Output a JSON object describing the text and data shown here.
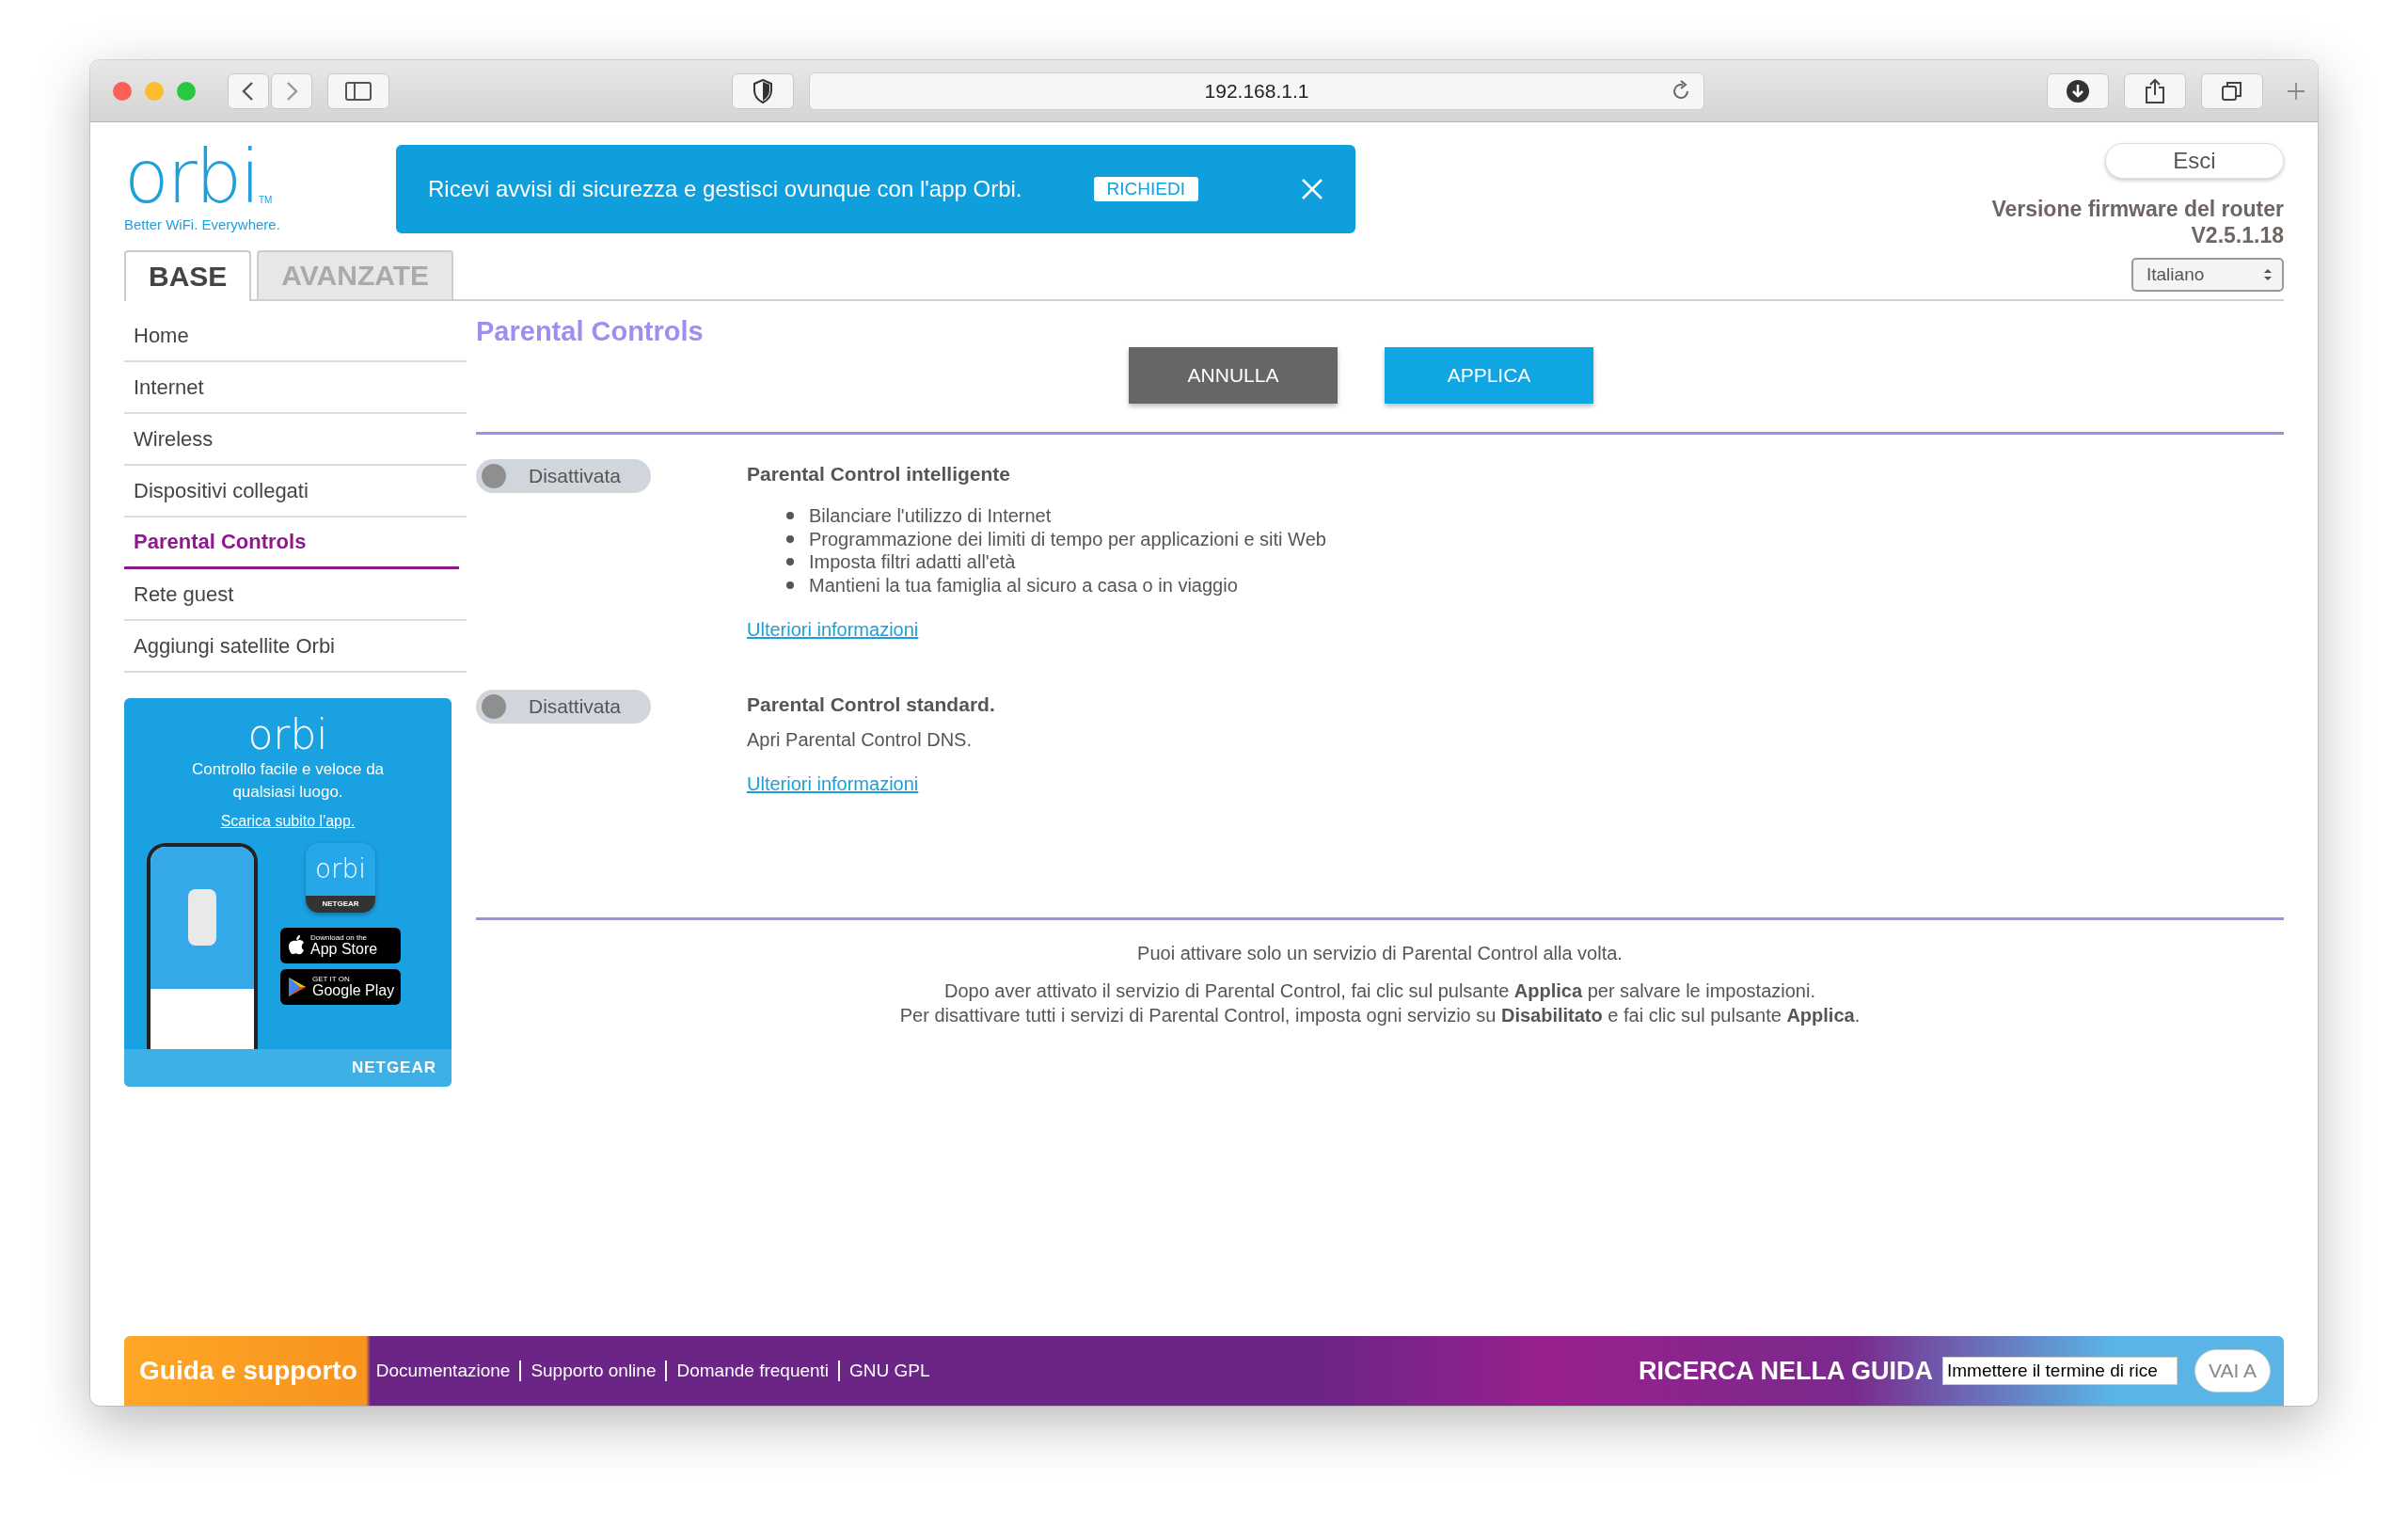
{
  "browser": {
    "url": "192.168.1.1"
  },
  "header": {
    "logo": "orbi",
    "logo_mark": "TM",
    "tagline": "Better WiFi. Everywhere.",
    "banner": {
      "text": "Ricevi avvisi di sicurezza e gestisci ovunque con l'app Orbi.",
      "button": "RICHIEDI"
    },
    "logout": "Esci",
    "firmware_label": "Versione firmware del router",
    "firmware_version": "V2.5.1.18",
    "language": "Italiano"
  },
  "tabs": [
    {
      "label": "BASE",
      "selected": true
    },
    {
      "label": "AVANZATE",
      "selected": false
    }
  ],
  "sidebar": {
    "items": [
      {
        "label": "Home",
        "selected": false
      },
      {
        "label": "Internet",
        "selected": false
      },
      {
        "label": "Wireless",
        "selected": false
      },
      {
        "label": "Dispositivi collegati",
        "selected": false
      },
      {
        "label": "Parental Controls",
        "selected": true
      },
      {
        "label": "Rete guest",
        "selected": false
      },
      {
        "label": "Aggiungi satellite Orbi",
        "selected": false
      }
    ]
  },
  "promo": {
    "logo": "orbi",
    "text": "Controllo facile e veloce da qualsiasi luogo.",
    "link": "Scarica subito l'app.",
    "app_icon_logo": "orbi",
    "app_icon_brand": "NETGEAR",
    "app_store": {
      "small": "Download on the",
      "big": "App Store"
    },
    "google_play": {
      "small": "GET IT ON",
      "big": "Google Play"
    },
    "brand": "NETGEAR"
  },
  "page": {
    "title": "Parental Controls",
    "buttons": [
      {
        "label": "ANNULLA",
        "kind": "cancel"
      },
      {
        "label": "APPLICA",
        "kind": "apply"
      }
    ],
    "services": [
      {
        "toggle_label": "Disattivata",
        "on": false,
        "title": "Parental Control intelligente",
        "bullets": [
          "Bilanciare l'utilizzo di Internet",
          "Programmazione dei limiti di tempo per applicazioni e siti Web",
          "Imposta filtri adatti all'età",
          "Mantieni la tua famiglia al sicuro a casa o in viaggio"
        ],
        "link": "Ulteriori informazioni"
      },
      {
        "toggle_label": "Disattivata",
        "on": false,
        "title": "Parental Control standard.",
        "description": "Apri Parental Control DNS.",
        "link": "Ulteriori informazioni"
      }
    ],
    "notes": [
      "Puoi attivare solo un servizio di Parental Control alla volta.",
      "Dopo aver attivato il servizio di Parental Control, fai clic sul pulsante **Applica** per salvare le impostazioni.",
      "Per disattivare tutti i servizi di Parental Control, imposta ogni servizio su **Disabilitato** e fai clic sul pulsante **Applica**."
    ]
  },
  "footer": {
    "title": "Guida e supporto",
    "links": [
      "Documentazione",
      "Supporto online",
      "Domande frequenti",
      "GNU GPL"
    ],
    "search_label": "RICERCA NELLA GUIDA",
    "search_value": "Immettere il termine di rice",
    "button": "VAI A"
  }
}
